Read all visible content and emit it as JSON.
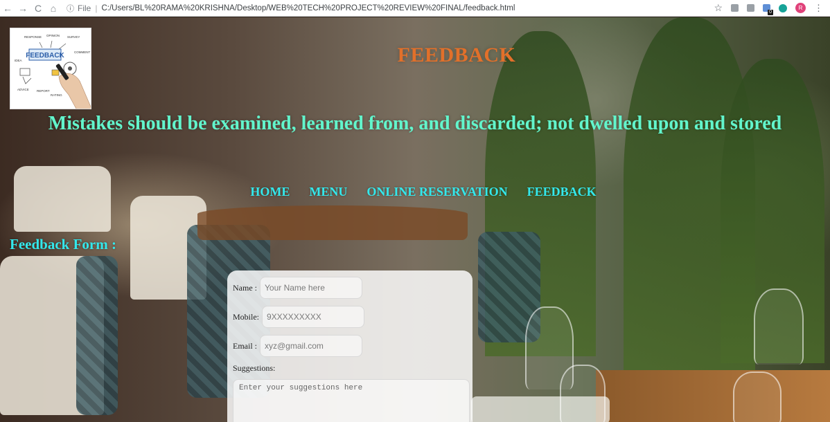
{
  "browser": {
    "back_icon": "←",
    "forward_icon": "→",
    "reload_icon": "C",
    "home_icon": "⌂",
    "info_icon": "ⓘ",
    "scheme": "File",
    "separator": "|",
    "url": "C:/Users/BL%20RAMA%20KRISHNA/Desktop/WEB%20TECH%20PROJECT%20REVIEW%20FINAL/feedback.html",
    "star_icon": "☆",
    "extension_badge": "0",
    "profile_initial": "R",
    "menu_icon": "⋮"
  },
  "header": {
    "logo_text": "FEEDBACK",
    "logo_words": [
      "RESPONSE",
      "OPINION",
      "SURVEY",
      "IDEA",
      "COMMENT",
      "ADVICE",
      "REPORT",
      "RATING"
    ],
    "title": "FEEDBACK",
    "quote": "Mistakes should be examined, learned from, and discarded; not dwelled upon and stored"
  },
  "nav": {
    "items": [
      {
        "label": "HOME"
      },
      {
        "label": "MENU"
      },
      {
        "label": "ONLINE RESERVATION"
      },
      {
        "label": "FEEDBACK"
      }
    ]
  },
  "form": {
    "heading": "Feedback Form :",
    "name_label": "Name :",
    "name_placeholder": "Your Name here",
    "mobile_label": "Mobile:",
    "mobile_placeholder": "9XXXXXXXXX",
    "email_label": "Email :",
    "email_placeholder": "xyz@gmail.com",
    "suggestions_label": "Suggestions:",
    "suggestions_placeholder": "Enter your suggestions here"
  },
  "colors": {
    "title": "#e2702a",
    "quote": "#62f5cc",
    "nav": "#33e8ec"
  }
}
